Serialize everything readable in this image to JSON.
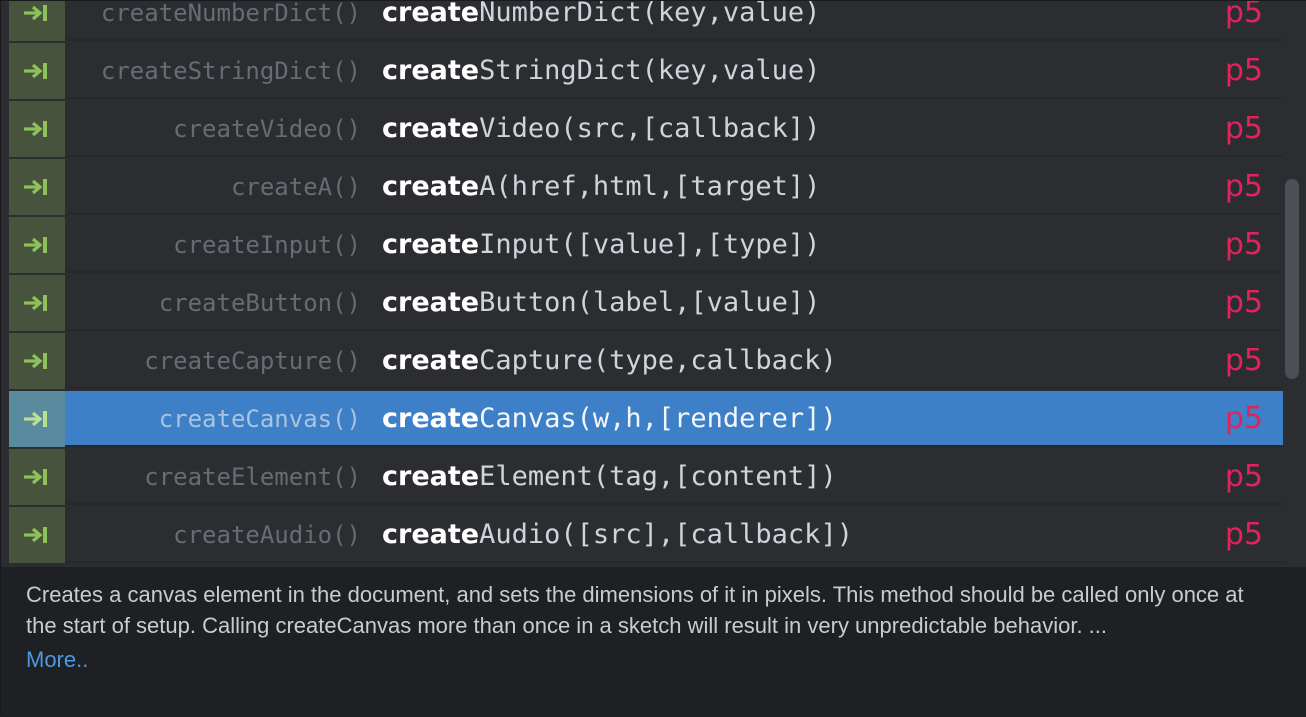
{
  "completions": [
    {
      "label": "createNumberDict()",
      "match": "create",
      "rest": "NumberDict(key,value)",
      "source": "p5",
      "selected": false
    },
    {
      "label": "createStringDict()",
      "match": "create",
      "rest": "StringDict(key,value)",
      "source": "p5",
      "selected": false
    },
    {
      "label": "createVideo()",
      "match": "create",
      "rest": "Video(src,[callback])",
      "source": "p5",
      "selected": false
    },
    {
      "label": "createA()",
      "match": "create",
      "rest": "A(href,html,[target])",
      "source": "p5",
      "selected": false
    },
    {
      "label": "createInput()",
      "match": "create",
      "rest": "Input([value],[type])",
      "source": "p5",
      "selected": false
    },
    {
      "label": "createButton()",
      "match": "create",
      "rest": "Button(label,[value])",
      "source": "p5",
      "selected": false
    },
    {
      "label": "createCapture()",
      "match": "create",
      "rest": "Capture(type,callback)",
      "source": "p5",
      "selected": false
    },
    {
      "label": "createCanvas()",
      "match": "create",
      "rest": "Canvas(w,h,[renderer])",
      "source": "p5",
      "selected": true
    },
    {
      "label": "createElement()",
      "match": "create",
      "rest": "Element(tag,[content])",
      "source": "p5",
      "selected": false
    },
    {
      "label": "createAudio()",
      "match": "create",
      "rest": "Audio([src],[callback])",
      "source": "p5",
      "selected": false
    }
  ],
  "badge_icon": "tab-snippet-icon",
  "doc": {
    "description": "Creates a canvas element in the document, and sets the dimensions of it in pixels. This method should be called only once at the start of setup. Calling createCanvas more than once in a sketch will result in very unpredictable behavior. ...",
    "more_label": "More.."
  },
  "colors": {
    "selected_row": "#3d80c7",
    "source_tag": "#e3225c",
    "badge_bg": "#47533c",
    "badge_arrow": "#8fc15a",
    "more_link": "#4d98e0"
  }
}
